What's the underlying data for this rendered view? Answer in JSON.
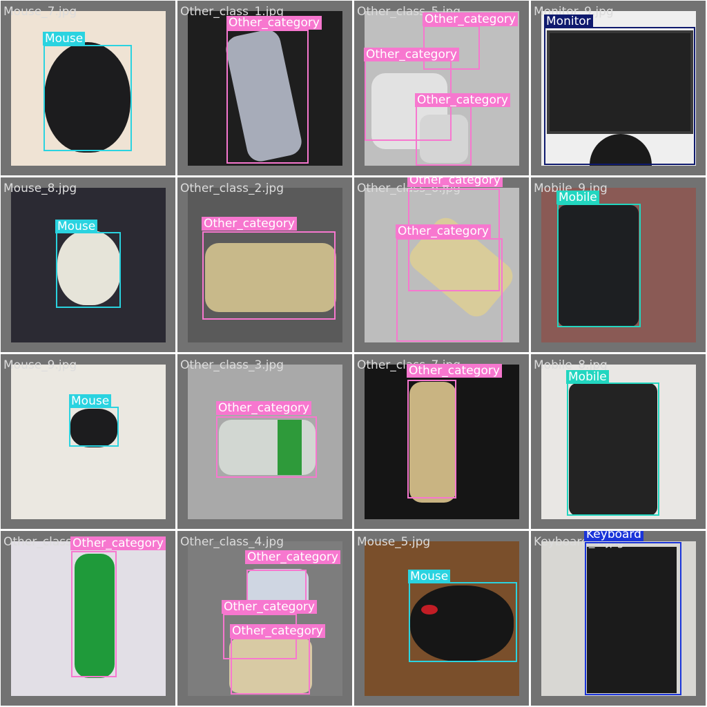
{
  "grid": {
    "cells": [
      {
        "filename": "Mouse_7.jpg",
        "labels": [
          "Mouse"
        ]
      },
      {
        "filename": "Other_class_1.jpg",
        "labels": [
          "Other_category"
        ]
      },
      {
        "filename": "Other_class_5.jpg",
        "labels": [
          "Other_category",
          "Other_category",
          "Other_category"
        ]
      },
      {
        "filename": "Monitor_9.jpg",
        "labels": [
          "Monitor"
        ]
      },
      {
        "filename": "Mouse_8.jpg",
        "labels": [
          "Mouse"
        ]
      },
      {
        "filename": "Other_class_2.jpg",
        "labels": [
          "Other_category"
        ]
      },
      {
        "filename": "Other_class_6.jpg",
        "labels": [
          "Other_category",
          "Other_category"
        ]
      },
      {
        "filename": "Mobile_9.jpg",
        "labels": [
          "Mobile"
        ]
      },
      {
        "filename": "Mouse_9.jpg",
        "labels": [
          "Mouse"
        ]
      },
      {
        "filename": "Other_class_3.jpg",
        "labels": [
          "Other_category"
        ]
      },
      {
        "filename": "Other_class_7.jpg",
        "labels": [
          "Other_category"
        ]
      },
      {
        "filename": "Mobile_8.jpg",
        "labels": [
          "Mobile"
        ]
      },
      {
        "filename": "Other_class_8.jpg",
        "labels": [
          "Other_category"
        ]
      },
      {
        "filename": "Other_class_4.jpg",
        "labels": [
          "Other_category",
          "Other_category",
          "Other_category"
        ]
      },
      {
        "filename": "Mouse_5.jpg",
        "labels": [
          "Mouse"
        ]
      },
      {
        "filename": "Keyboard_1.jpg",
        "labels": [
          "Keyboard"
        ]
      }
    ]
  },
  "colors": {
    "Mouse": "#2ad3e0",
    "Other_category": "#f777cf",
    "Monitor": "#0f1a6e",
    "Mobile": "#22d6c0",
    "Keyboard": "#1a34d9",
    "cell_background": "#727272",
    "grid_lines": "#ffffff"
  }
}
